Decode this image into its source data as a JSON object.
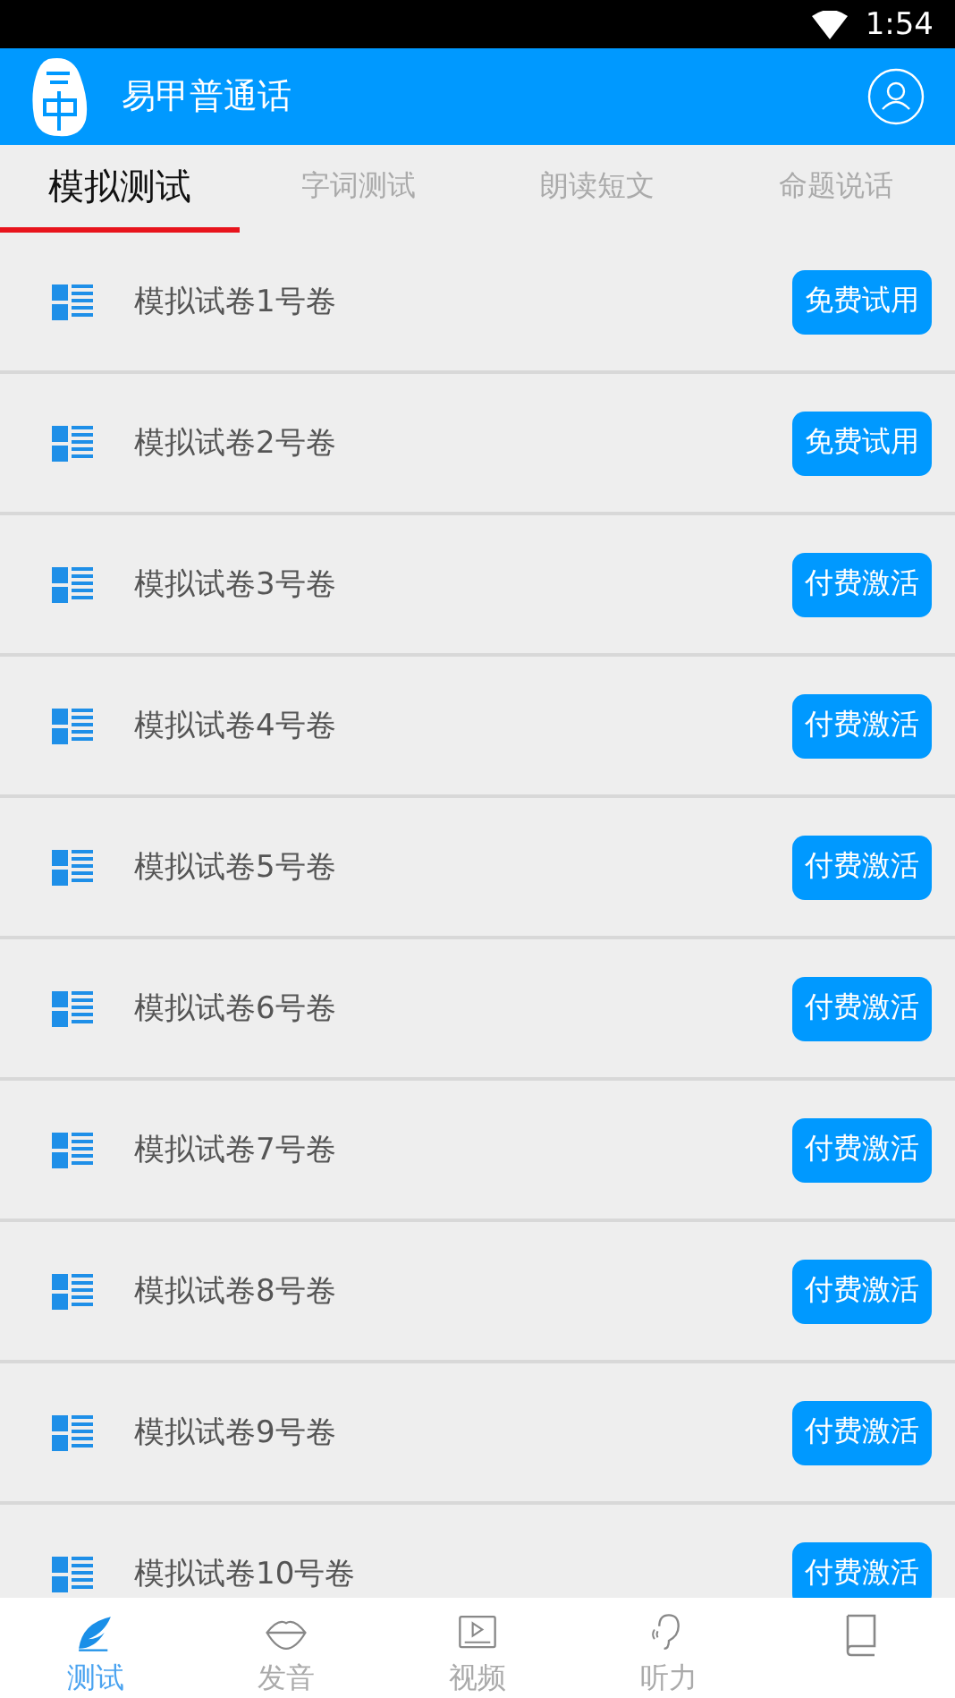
{
  "status_bar": {
    "time": "1:54"
  },
  "header": {
    "title": "易甲普通话"
  },
  "tabs": [
    {
      "label": "模拟测试",
      "selected": true
    },
    {
      "label": "字词测试",
      "selected": false
    },
    {
      "label": "朗读短文",
      "selected": false
    },
    {
      "label": "命题说话",
      "selected": false
    }
  ],
  "papers": [
    {
      "title": "模拟试卷1号卷",
      "action": "免费试用"
    },
    {
      "title": "模拟试卷2号卷",
      "action": "免费试用"
    },
    {
      "title": "模拟试卷3号卷",
      "action": "付费激活"
    },
    {
      "title": "模拟试卷4号卷",
      "action": "付费激活"
    },
    {
      "title": "模拟试卷5号卷",
      "action": "付费激活"
    },
    {
      "title": "模拟试卷6号卷",
      "action": "付费激活"
    },
    {
      "title": "模拟试卷7号卷",
      "action": "付费激活"
    },
    {
      "title": "模拟试卷8号卷",
      "action": "付费激活"
    },
    {
      "title": "模拟试卷9号卷",
      "action": "付费激活"
    },
    {
      "title": "模拟试卷10号卷",
      "action": "付费激活"
    }
  ],
  "bottom_nav": [
    {
      "kind": "feather",
      "label": "测试",
      "selected": true
    },
    {
      "kind": "lips",
      "label": "发音",
      "selected": false
    },
    {
      "kind": "video",
      "label": "视频",
      "selected": false
    },
    {
      "kind": "ear",
      "label": "听力",
      "selected": false
    },
    {
      "kind": "book",
      "selected": false
    }
  ]
}
